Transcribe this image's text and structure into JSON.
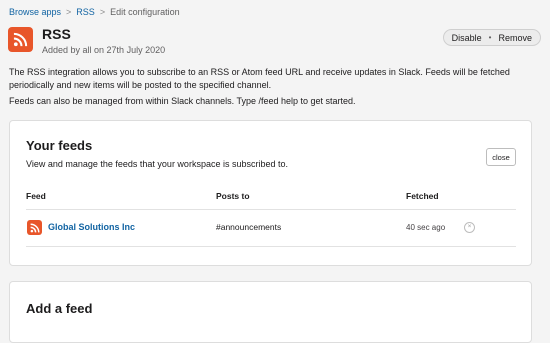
{
  "breadcrumb": {
    "items": [
      "Browse apps",
      "RSS",
      "Edit configuration"
    ],
    "separator": ">"
  },
  "app": {
    "name": "RSS",
    "added_by": "Added by all on 27th July 2020",
    "icon": "rss-icon",
    "brand_color": "#e8562a"
  },
  "actions": {
    "disable": "Disable",
    "separator": "•",
    "remove": "Remove"
  },
  "description": {
    "para1": "The RSS integration allows you to subscribe to an RSS or Atom feed URL and receive updates in Slack. Feeds will be fetched periodically and new items will be posted to the specified channel.",
    "para2": "Feeds can also be managed from within Slack channels. Type /feed help to get started."
  },
  "feeds_card": {
    "title": "Your feeds",
    "subtitle": "View and manage the feeds that your workspace is subscribed to.",
    "close_label": "close",
    "columns": [
      "Feed",
      "Posts to",
      "Fetched"
    ],
    "rows": [
      {
        "feed": "Global Solutions Inc",
        "posts_to": "#announcements",
        "fetched": "40 sec ago",
        "remove_glyph": "×"
      }
    ]
  },
  "add_card": {
    "title": "Add a feed"
  },
  "colors": {
    "link": "#1264a3",
    "background": "#f4f4f4",
    "card": "#ffffff"
  }
}
